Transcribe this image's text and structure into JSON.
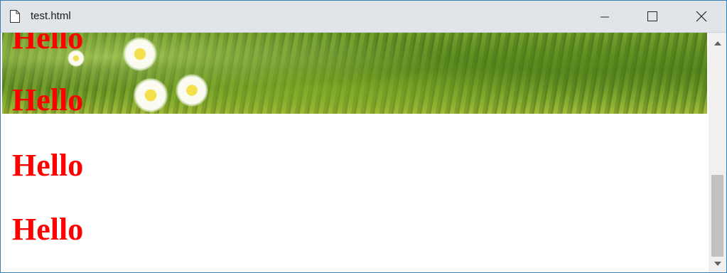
{
  "window": {
    "title": "test.html",
    "icons": {
      "document": "document-icon",
      "minimize": "minimize-icon",
      "maximize": "maximize-icon",
      "close": "close-icon"
    }
  },
  "page": {
    "headings": [
      "Hello",
      "Hello",
      "Hello",
      "Hello"
    ],
    "text_color": "#ff0000"
  },
  "scrollbar": {
    "icons": {
      "up": "scroll-up-arrow-icon",
      "down": "scroll-down-arrow-icon"
    }
  }
}
